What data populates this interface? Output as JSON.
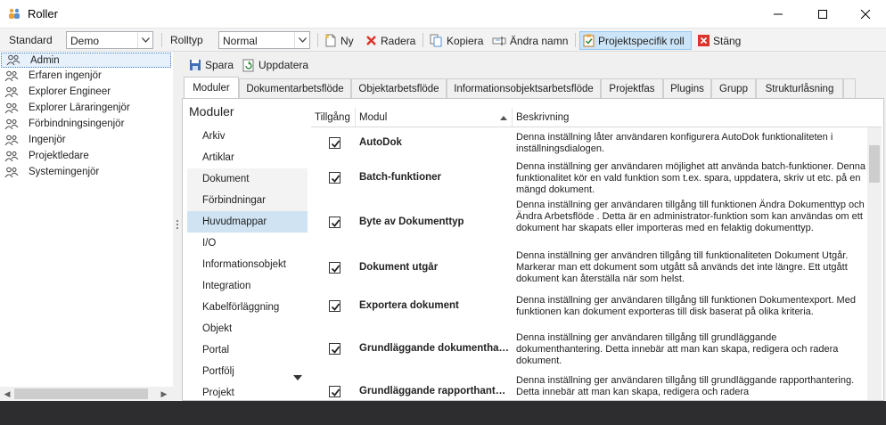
{
  "window": {
    "title": "Roller"
  },
  "toolbar": {
    "standard_label": "Standard",
    "standard_value": "Demo",
    "rolltyp_label": "Rolltyp",
    "rolltyp_value": "Normal",
    "new_label": "Ny",
    "delete_label": "Radera",
    "copy_label": "Kopiera",
    "rename_label": "Ändra namn",
    "project_role_label": "Projektspecifik roll",
    "close_label": "Stäng"
  },
  "roles": [
    "Admin",
    "Erfaren ingenjör",
    "Explorer Engineer",
    "Explorer Lärar­ingenjör",
    "Förbindningsingenjör",
    "Ingenjör",
    "Projektledare",
    "Systemingenjör"
  ],
  "actions": {
    "save_label": "Spara",
    "refresh_label": "Uppdatera"
  },
  "tabs": [
    "Moduler",
    "Dokumentarbetsflöde",
    "Objektarbetsflöde",
    "Informationsobjektsarbetsflöde",
    "Projektfas",
    "Plugins",
    "Grupp",
    "Strukturlåsning"
  ],
  "modules_heading": "Moduler",
  "modules": [
    "Arkiv",
    "Artiklar",
    "Dokument",
    "Förbindningar",
    "Huvudmappar",
    "I/O",
    "Informationsobjekt",
    "Integration",
    "Kabelförläggning",
    "Objekt",
    "Portal",
    "Portfölj",
    "Projekt"
  ],
  "selected_module": "Huvudmappar",
  "grid": {
    "col_access": "Tillgång",
    "col_module": "Modul",
    "col_desc": "Beskrivning",
    "rows": [
      {
        "checked": true,
        "module": "AutoDok",
        "desc": "Denna inställning låter användaren konfigurera AutoDok funktionaliteten i inställningsdialogen."
      },
      {
        "checked": true,
        "module": "Batch-funktioner",
        "desc": "Denna inställning ger användaren möjlighet att använda batch-funktioner. Denna funktionalitet kör en vald funktion som t.ex. spara, uppdatera, skriv ut etc. på en mängd dokument."
      },
      {
        "checked": true,
        "module": "Byte av Dokumenttyp",
        "desc": "Denna inställning ger användaren tillgång till funktionen Ändra Dokumenttyp och Ändra Arbetsflöde . Detta är en administrator-funktion som kan användas om ett dokument har skapats eller importeras med en felaktig dokumenttyp."
      },
      {
        "checked": true,
        "module": "Dokument utgår",
        "desc": "Denna inställning ger användren tillgång till funktionaliteten Dokument Utgår. Markerar man ett dokument som utgått så används det inte längre. Ett utgått dokument kan återställa när som helst."
      },
      {
        "checked": true,
        "module": "Exportera dokument",
        "desc": "Denna inställning ger användaren tillgång till funktionen Dokumentexport. Med funktionen kan dokument exporteras till disk baserat på olika kriteria."
      },
      {
        "checked": true,
        "module": "Grundläggande dokumenthantering",
        "desc": "Denna inställning ger användaren tillgång till grundläggande dokumenthantering. Detta innebär att man kan skapa, redigera och radera dokument."
      },
      {
        "checked": true,
        "module": "Grundläggande rapporthantering",
        "desc": "Denna inställning ger användaren tillgång till grundläggande rapporthantering. Detta innebär att man kan skapa, redigera och radera"
      }
    ]
  },
  "colors": {
    "selection": "#cfe3f3",
    "accent": "#3b7fc4",
    "statusbar": "#2d2d30"
  }
}
